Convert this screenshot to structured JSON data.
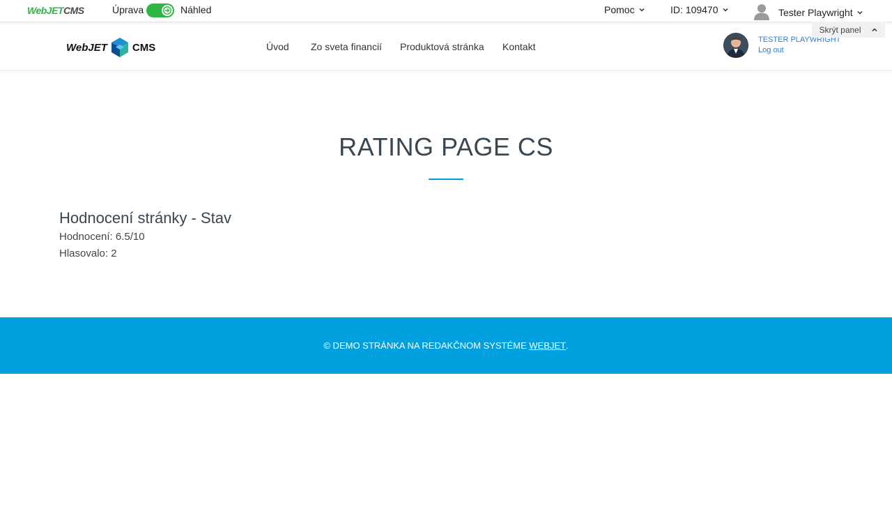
{
  "admin_bar": {
    "logo_web": "WebJET",
    "logo_cms": "CMS",
    "mode_edit_label": "Úprava",
    "mode_preview_label": "Náhled",
    "toggle_color": "#2db742",
    "help_label": "Pomoc",
    "id_label": "ID: 109470",
    "user_label": "Tester Playwright",
    "hide_panel_label": "Skrýt panel"
  },
  "header": {
    "logo_text_1": "WebJET",
    "logo_text_2": "CMS",
    "nav": [
      "Úvod",
      "Zo sveta financií",
      "Produktová stránka",
      "Kontakt"
    ],
    "user_name": "TESTER PLAYWRIGHT",
    "logout_label": "Log out"
  },
  "main": {
    "title": "RATING PAGE CS",
    "accent_color": "#00a0df",
    "rating_heading": "Hodnocení stránky - Stav",
    "rating_value": "Hodnocení: 6.5/10",
    "votes": "Hlasovalo: 2"
  },
  "footer": {
    "text": "© DEMO STRÁNKA NA REDAKČNOM SYSTÉME",
    "link": "WEBJET",
    "suffix": ".",
    "background": "#00a0df"
  }
}
